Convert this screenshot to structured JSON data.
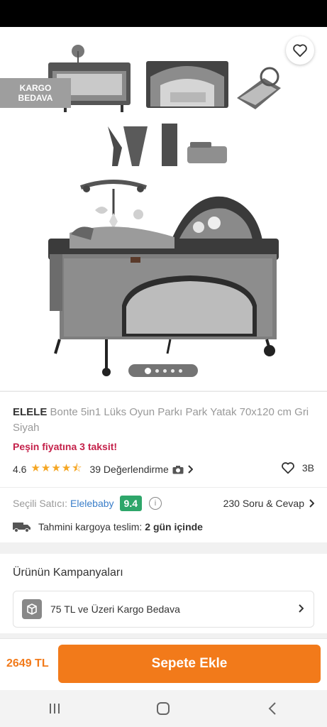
{
  "badge": {
    "line1": "KARGO",
    "line2": "BEDAVA"
  },
  "product": {
    "brand": "ELELE",
    "name": "Bonte 5in1 Lüks Oyun Parkı Park Yatak 70x120 cm Gri Siyah",
    "installment": "Peşin fiyatına 3 taksit!",
    "rating": "4.6",
    "rating_fraction": 0.92,
    "reviews": "39 Değerlendirme",
    "likes": "3B"
  },
  "gallery": {
    "total": 5,
    "active": 1
  },
  "seller": {
    "label": "Seçili Satıcı:",
    "name": "Elelebaby",
    "score": "9.4",
    "qa": "230 Soru & Cevap"
  },
  "delivery": {
    "label": "Tahmini kargoya teslim:",
    "value": "2 gün içinde"
  },
  "campaigns": {
    "title": "Ürünün Kampanyaları",
    "item": "75 TL ve Üzeri Kargo Bedava"
  },
  "cart": {
    "price": "2649 TL",
    "button": "Sepete Ekle"
  },
  "colors": {
    "accent": "#f27a1a",
    "installment": "#c4214a",
    "score": "#2ea66a",
    "seller": "#3a7ec9",
    "star": "#f5a623"
  }
}
